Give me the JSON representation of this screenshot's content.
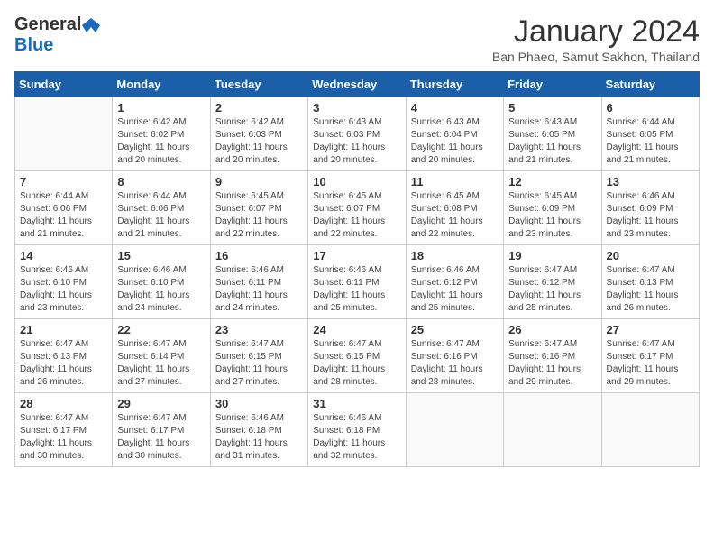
{
  "header": {
    "logo_general": "General",
    "logo_blue": "Blue",
    "title": "January 2024",
    "subtitle": "Ban Phaeo, Samut Sakhon, Thailand"
  },
  "days_of_week": [
    "Sunday",
    "Monday",
    "Tuesday",
    "Wednesday",
    "Thursday",
    "Friday",
    "Saturday"
  ],
  "weeks": [
    [
      {
        "day": "",
        "info": ""
      },
      {
        "day": "1",
        "info": "Sunrise: 6:42 AM\nSunset: 6:02 PM\nDaylight: 11 hours\nand 20 minutes."
      },
      {
        "day": "2",
        "info": "Sunrise: 6:42 AM\nSunset: 6:03 PM\nDaylight: 11 hours\nand 20 minutes."
      },
      {
        "day": "3",
        "info": "Sunrise: 6:43 AM\nSunset: 6:03 PM\nDaylight: 11 hours\nand 20 minutes."
      },
      {
        "day": "4",
        "info": "Sunrise: 6:43 AM\nSunset: 6:04 PM\nDaylight: 11 hours\nand 20 minutes."
      },
      {
        "day": "5",
        "info": "Sunrise: 6:43 AM\nSunset: 6:05 PM\nDaylight: 11 hours\nand 21 minutes."
      },
      {
        "day": "6",
        "info": "Sunrise: 6:44 AM\nSunset: 6:05 PM\nDaylight: 11 hours\nand 21 minutes."
      }
    ],
    [
      {
        "day": "7",
        "info": "Sunrise: 6:44 AM\nSunset: 6:06 PM\nDaylight: 11 hours\nand 21 minutes."
      },
      {
        "day": "8",
        "info": "Sunrise: 6:44 AM\nSunset: 6:06 PM\nDaylight: 11 hours\nand 21 minutes."
      },
      {
        "day": "9",
        "info": "Sunrise: 6:45 AM\nSunset: 6:07 PM\nDaylight: 11 hours\nand 22 minutes."
      },
      {
        "day": "10",
        "info": "Sunrise: 6:45 AM\nSunset: 6:07 PM\nDaylight: 11 hours\nand 22 minutes."
      },
      {
        "day": "11",
        "info": "Sunrise: 6:45 AM\nSunset: 6:08 PM\nDaylight: 11 hours\nand 22 minutes."
      },
      {
        "day": "12",
        "info": "Sunrise: 6:45 AM\nSunset: 6:09 PM\nDaylight: 11 hours\nand 23 minutes."
      },
      {
        "day": "13",
        "info": "Sunrise: 6:46 AM\nSunset: 6:09 PM\nDaylight: 11 hours\nand 23 minutes."
      }
    ],
    [
      {
        "day": "14",
        "info": "Sunrise: 6:46 AM\nSunset: 6:10 PM\nDaylight: 11 hours\nand 23 minutes."
      },
      {
        "day": "15",
        "info": "Sunrise: 6:46 AM\nSunset: 6:10 PM\nDaylight: 11 hours\nand 24 minutes."
      },
      {
        "day": "16",
        "info": "Sunrise: 6:46 AM\nSunset: 6:11 PM\nDaylight: 11 hours\nand 24 minutes."
      },
      {
        "day": "17",
        "info": "Sunrise: 6:46 AM\nSunset: 6:11 PM\nDaylight: 11 hours\nand 25 minutes."
      },
      {
        "day": "18",
        "info": "Sunrise: 6:46 AM\nSunset: 6:12 PM\nDaylight: 11 hours\nand 25 minutes."
      },
      {
        "day": "19",
        "info": "Sunrise: 6:47 AM\nSunset: 6:12 PM\nDaylight: 11 hours\nand 25 minutes."
      },
      {
        "day": "20",
        "info": "Sunrise: 6:47 AM\nSunset: 6:13 PM\nDaylight: 11 hours\nand 26 minutes."
      }
    ],
    [
      {
        "day": "21",
        "info": "Sunrise: 6:47 AM\nSunset: 6:13 PM\nDaylight: 11 hours\nand 26 minutes."
      },
      {
        "day": "22",
        "info": "Sunrise: 6:47 AM\nSunset: 6:14 PM\nDaylight: 11 hours\nand 27 minutes."
      },
      {
        "day": "23",
        "info": "Sunrise: 6:47 AM\nSunset: 6:15 PM\nDaylight: 11 hours\nand 27 minutes."
      },
      {
        "day": "24",
        "info": "Sunrise: 6:47 AM\nSunset: 6:15 PM\nDaylight: 11 hours\nand 28 minutes."
      },
      {
        "day": "25",
        "info": "Sunrise: 6:47 AM\nSunset: 6:16 PM\nDaylight: 11 hours\nand 28 minutes."
      },
      {
        "day": "26",
        "info": "Sunrise: 6:47 AM\nSunset: 6:16 PM\nDaylight: 11 hours\nand 29 minutes."
      },
      {
        "day": "27",
        "info": "Sunrise: 6:47 AM\nSunset: 6:17 PM\nDaylight: 11 hours\nand 29 minutes."
      }
    ],
    [
      {
        "day": "28",
        "info": "Sunrise: 6:47 AM\nSunset: 6:17 PM\nDaylight: 11 hours\nand 30 minutes."
      },
      {
        "day": "29",
        "info": "Sunrise: 6:47 AM\nSunset: 6:17 PM\nDaylight: 11 hours\nand 30 minutes."
      },
      {
        "day": "30",
        "info": "Sunrise: 6:46 AM\nSunset: 6:18 PM\nDaylight: 11 hours\nand 31 minutes."
      },
      {
        "day": "31",
        "info": "Sunrise: 6:46 AM\nSunset: 6:18 PM\nDaylight: 11 hours\nand 32 minutes."
      },
      {
        "day": "",
        "info": ""
      },
      {
        "day": "",
        "info": ""
      },
      {
        "day": "",
        "info": ""
      }
    ]
  ]
}
